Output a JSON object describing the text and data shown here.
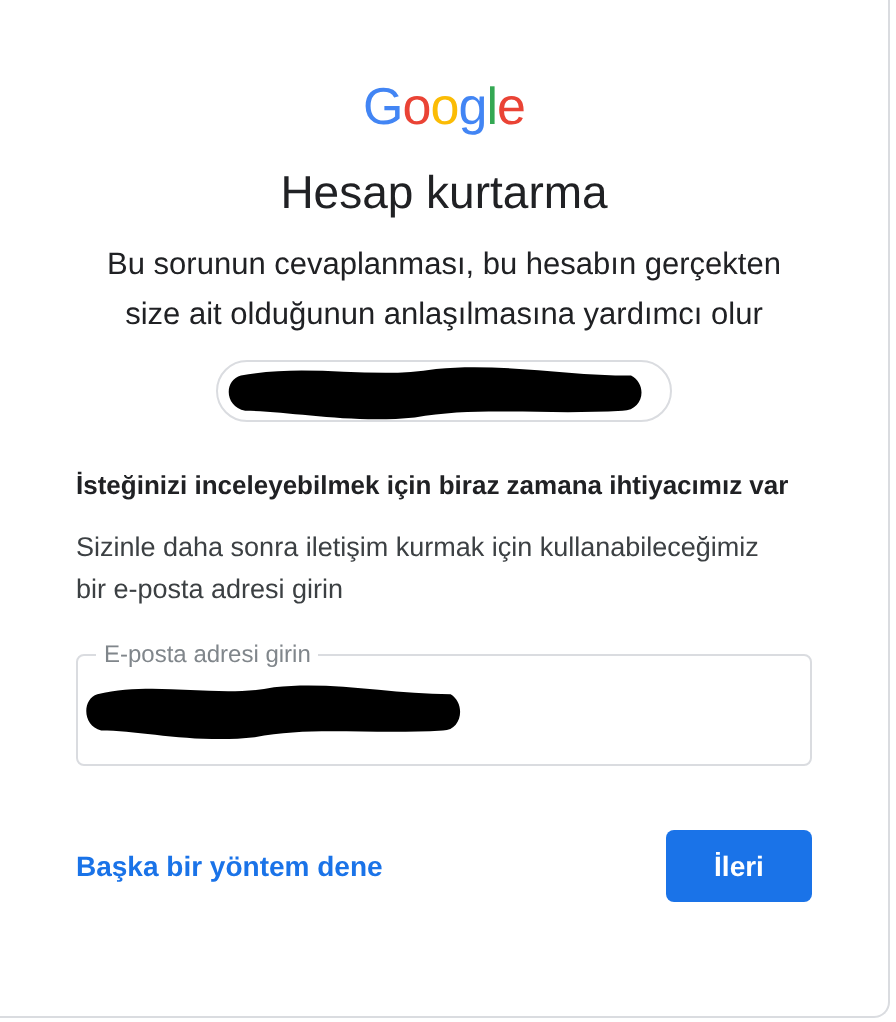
{
  "logo": "Google",
  "title": "Hesap kurtarma",
  "subtitle": "Bu sorunun cevaplanması, bu hesabın gerçekten size ait olduğunun anlaşılmasına yardımcı olur",
  "notice": "İsteğinizi inceleyebilmek için biraz zamana ihtiyacımız var",
  "instruction": "Sizinle daha sonra iletişim kurmak için kullanabileceğimiz bir e-posta adresi girin",
  "email_field": {
    "label": "E-posta adresi girin"
  },
  "link": "Başka bir yöntem dene",
  "next_button": "İleri"
}
